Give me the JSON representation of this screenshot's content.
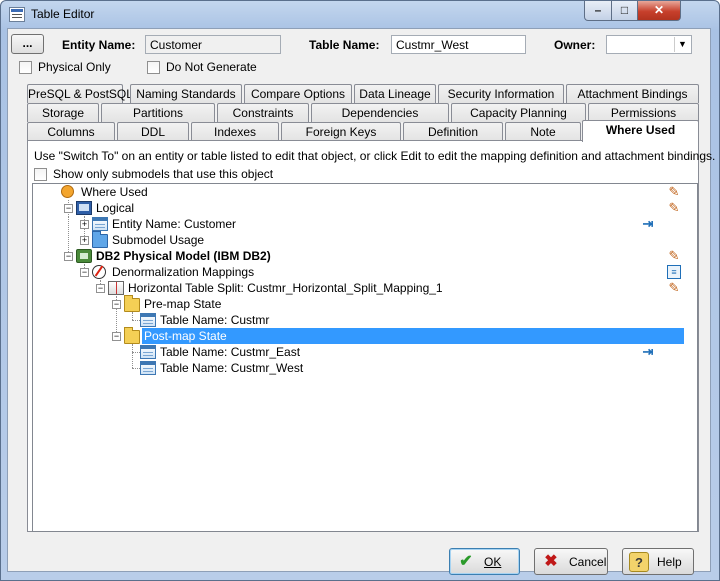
{
  "window": {
    "title": "Table Editor",
    "minimize_glyph": "–",
    "maximize_glyph": "□",
    "close_glyph": "✕"
  },
  "header": {
    "ellipsis_label": "...",
    "entity_name_label": "Entity Name:",
    "entity_name_value": "Customer",
    "table_name_label": "Table Name:",
    "table_name_value": "Custmr_West",
    "owner_label": "Owner:",
    "owner_value": "",
    "physical_only_label": "Physical Only",
    "do_not_generate_label": "Do Not Generate"
  },
  "tabs": {
    "row1": [
      "PreSQL & PostSQL",
      "Naming Standards",
      "Compare Options",
      "Data Lineage",
      "Security Information",
      "Attachment Bindings"
    ],
    "row2": [
      "Storage",
      "Partitions",
      "Constraints",
      "Dependencies",
      "Capacity Planning",
      "Permissions"
    ],
    "row3": [
      "Columns",
      "DDL",
      "Indexes",
      "Foreign Keys",
      "Definition",
      "Note",
      "Where Used"
    ],
    "active": "Where Used"
  },
  "panel": {
    "info": "Use \"Switch To\" on an entity or table listed to edit that object, or click Edit to edit the mapping definition and attachment bindings.",
    "show_only_label": "Show only submodels that use this object"
  },
  "tree": {
    "nodes": [
      {
        "label": "Where Used",
        "icon": "where-used-icon",
        "action": "edit-icon"
      },
      {
        "label": "Logical",
        "icon": "logical-model-icon",
        "action": "edit-icon"
      },
      {
        "label": "Entity Name: Customer",
        "icon": "table-icon",
        "action": "switch-to-icon"
      },
      {
        "label": "Submodel Usage",
        "icon": "folder-icon",
        "action": ""
      },
      {
        "label": "DB2 Physical Model (IBM DB2)",
        "icon": "physical-model-icon",
        "action": "edit-icon"
      },
      {
        "label": "Denormalization Mappings",
        "icon": "compass-icon",
        "action": "list-icon"
      },
      {
        "label": "Horizontal Table Split: Custmr_Horizontal_Split_Mapping_1",
        "icon": "split-icon",
        "action": "edit-icon"
      },
      {
        "label": "Pre-map State",
        "icon": "folder-icon",
        "action": ""
      },
      {
        "label": "Table Name: Custmr",
        "icon": "table-icon",
        "action": ""
      },
      {
        "label": "Post-map State",
        "icon": "folder-icon",
        "action": "",
        "selected": true
      },
      {
        "label": "Table Name: Custmr_East",
        "icon": "table-icon",
        "action": "switch-to-icon"
      },
      {
        "label": "Table Name: Custmr_West",
        "icon": "table-icon",
        "action": ""
      }
    ]
  },
  "buttons": {
    "ok": "OK",
    "cancel": "Cancel",
    "help": "Help",
    "ok_glyph": "✔",
    "cancel_glyph": "✖",
    "help_glyph": "?"
  }
}
